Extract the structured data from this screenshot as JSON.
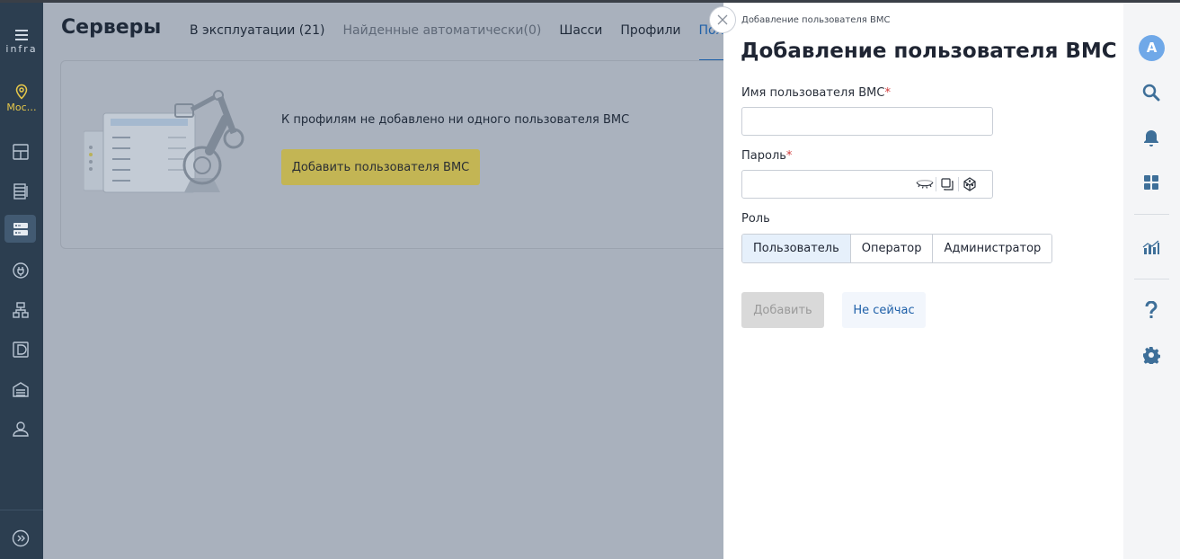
{
  "app": {
    "logo_text": "infra",
    "location_label": "Мос…"
  },
  "page": {
    "title": "Серверы",
    "tabs": [
      {
        "label": "В эксплуатации (21)"
      },
      {
        "label": "Найденные автоматически(0)"
      },
      {
        "label": "Шасси"
      },
      {
        "label": "Профили"
      },
      {
        "label": "Пользовате"
      }
    ]
  },
  "empty_state": {
    "text": "К профилям не добавлено ни одного пользователя BMC",
    "button_label": "Добавить пользователя BMC"
  },
  "drawer": {
    "breadcrumb": "Добавление пользователя BMC",
    "title": "Добавление пользователя BMC",
    "username_label": "Имя пользователя BMC",
    "password_label": "Пароль",
    "required_mark": "*",
    "username_value": "",
    "password_value": "",
    "role_label": "Роль",
    "roles": [
      "Пользователь",
      "Оператор",
      "Администратор"
    ],
    "selected_role": "Пользователь",
    "submit_label": "Добавить",
    "cancel_label": "Не сейчас"
  },
  "right_nav": {
    "avatar_letter": "A"
  },
  "colors": {
    "nav_bg": "#2c3e50",
    "accent_blue": "#1d5fa8",
    "primary_yellow": "#c3b554",
    "location_yellow": "#e7c84a",
    "required_red": "#d13b3b",
    "avatar_blue": "#6fa8e8"
  },
  "icons": {
    "left_nav": [
      "menu-icon",
      "location-pin-icon",
      "dashboard-icon",
      "rack-icon",
      "server-icon",
      "power-icon",
      "network-icon",
      "storage-icon",
      "datacenter-icon",
      "user-icon",
      "collapse-icon"
    ],
    "right_nav": [
      "search-icon",
      "bell-icon",
      "apps-grid-icon",
      "analytics-icon",
      "help-icon",
      "settings-icon"
    ],
    "password_field": [
      "show-password-icon",
      "copy-icon",
      "generate-password-icon"
    ]
  }
}
